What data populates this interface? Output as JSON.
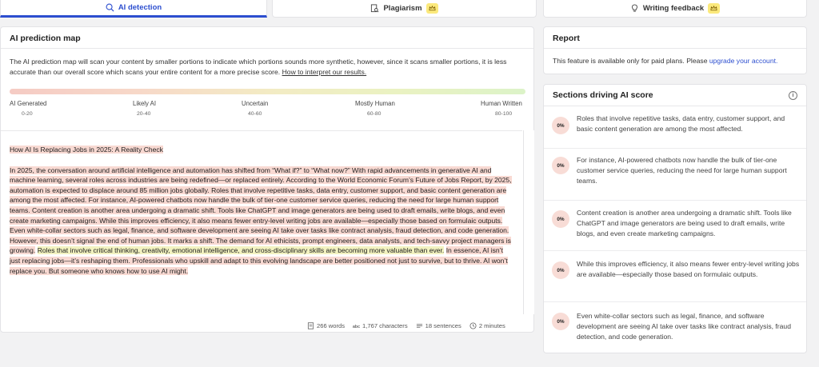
{
  "tabs": [
    {
      "label": "AI detection",
      "active": true,
      "icon": "ai-detect-icon"
    },
    {
      "label": "Plagiarism",
      "premium": true,
      "icon": "document-search-icon"
    },
    {
      "label": "Writing feedback",
      "premium": true,
      "icon": "lightbulb-icon"
    }
  ],
  "prediction_map": {
    "title": "AI prediction map",
    "description": "The AI prediction map will scan your content by smaller portions to indicate which portions sounds more synthetic, however, since it scans smaller portions, it is less accurate than our overall score which scans your entire content for a more precise score.",
    "link": "How to interpret our results.",
    "scale": [
      {
        "label": "AI Generated",
        "range": "0-20"
      },
      {
        "label": "Likely AI",
        "range": "20-40"
      },
      {
        "label": "Uncertain",
        "range": "40-60"
      },
      {
        "label": "Mostly Human",
        "range": "60-80"
      },
      {
        "label": "Human Written",
        "range": "80-100"
      }
    ]
  },
  "article": {
    "title": "How AI Is Replacing Jobs in 2025: A Reality Check",
    "paragraph_red_1": "In 2025, the conversation around artificial intelligence and automation has shifted from “What if?” to “What now?” With rapid advancements in generative AI and machine learning, several roles across industries are being redefined—or replaced entirely. According to the World Economic Forum’s Future of Jobs Report, by 2025, automation is expected to displace around 85 million jobs globally. Roles that involve repetitive tasks, data entry, customer support, and basic content generation are among the most affected. For instance, AI-powered chatbots now handle the bulk of tier-one customer service queries, reducing the need for large human support teams. Content creation is another area undergoing a dramatic shift. Tools like ChatGPT and image generators are being used to draft emails, write blogs, and even create marketing campaigns. While this improves efficiency, it also means fewer entry-level writing jobs are available—especially those based on formulaic outputs. Even white-collar sectors such as legal, finance, and software development are seeing AI take over tasks like contract analysis, fraud detection, and code generation. However, this doesn’t signal the end of human jobs. It marks a shift. The demand for AI ethicists, prompt engineers, data analysts, and tech-savvy project managers is growing.",
    "paragraph_yellow": "Roles that involve critical thinking, creativity, emotional intelligence, and cross-disciplinary skills are becoming more valuable than ever.",
    "paragraph_red_2": "In essence, AI isn’t just replacing jobs—it’s reshaping them. Professionals who upskill and adapt to this evolving landscape are better positioned not just to survive, but to thrive. AI won’t replace you. But someone who knows how to use AI might."
  },
  "stats": {
    "words": "266 words",
    "characters": "1,767 characters",
    "sentences": "18 sentences",
    "time": "2 minutes"
  },
  "report": {
    "title": "Report",
    "text": "This feature is available only for paid plans. Please",
    "link": "upgrade your account."
  },
  "sections": {
    "title": "Sections driving AI score",
    "items": [
      {
        "score": "0%",
        "text": "Roles that involve repetitive tasks, data entry, customer support, and basic content generation are among the most affected."
      },
      {
        "score": "0%",
        "text": "For instance, AI-powered chatbots now handle the bulk of tier-one customer service queries, reducing the need for large human support teams."
      },
      {
        "score": "0%",
        "text": "Content creation is another area undergoing a dramatic shift. Tools like ChatGPT and image generators are being used to draft emails, write blogs, and even create marketing campaigns."
      },
      {
        "score": "0%",
        "text": "While this improves efficiency, it also means fewer entry-level writing jobs are available—especially those based on formulaic outputs."
      },
      {
        "score": "0%",
        "text": "Even white-collar sectors such as legal, finance, and software development are seeing AI take over tasks like contract analysis, fraud detection, and code generation."
      }
    ]
  },
  "colors": {
    "accent": "#2c4ecf",
    "ai_highlight": "#f8d9d2",
    "mixed_highlight": "#f2f2c0",
    "premium": "#fbe97c"
  }
}
